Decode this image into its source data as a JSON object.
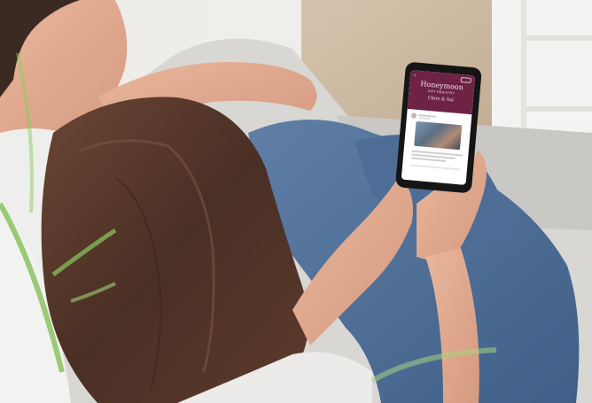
{
  "phone_app": {
    "header": {
      "title": "Honeymoon",
      "subtitle": "GIFT REGISTRY",
      "names": "Chris & Sal",
      "back_icon": "chevron-left-icon",
      "menu_icon": "pill-button-icon",
      "color": "#6e2244"
    },
    "post": {
      "avatar_icon": "avatar-icon",
      "image": "couple-photo"
    }
  },
  "scene": {
    "description_icons": [
      "man",
      "woman",
      "smartphone",
      "sofa",
      "shelf",
      "plant-leaves"
    ]
  }
}
